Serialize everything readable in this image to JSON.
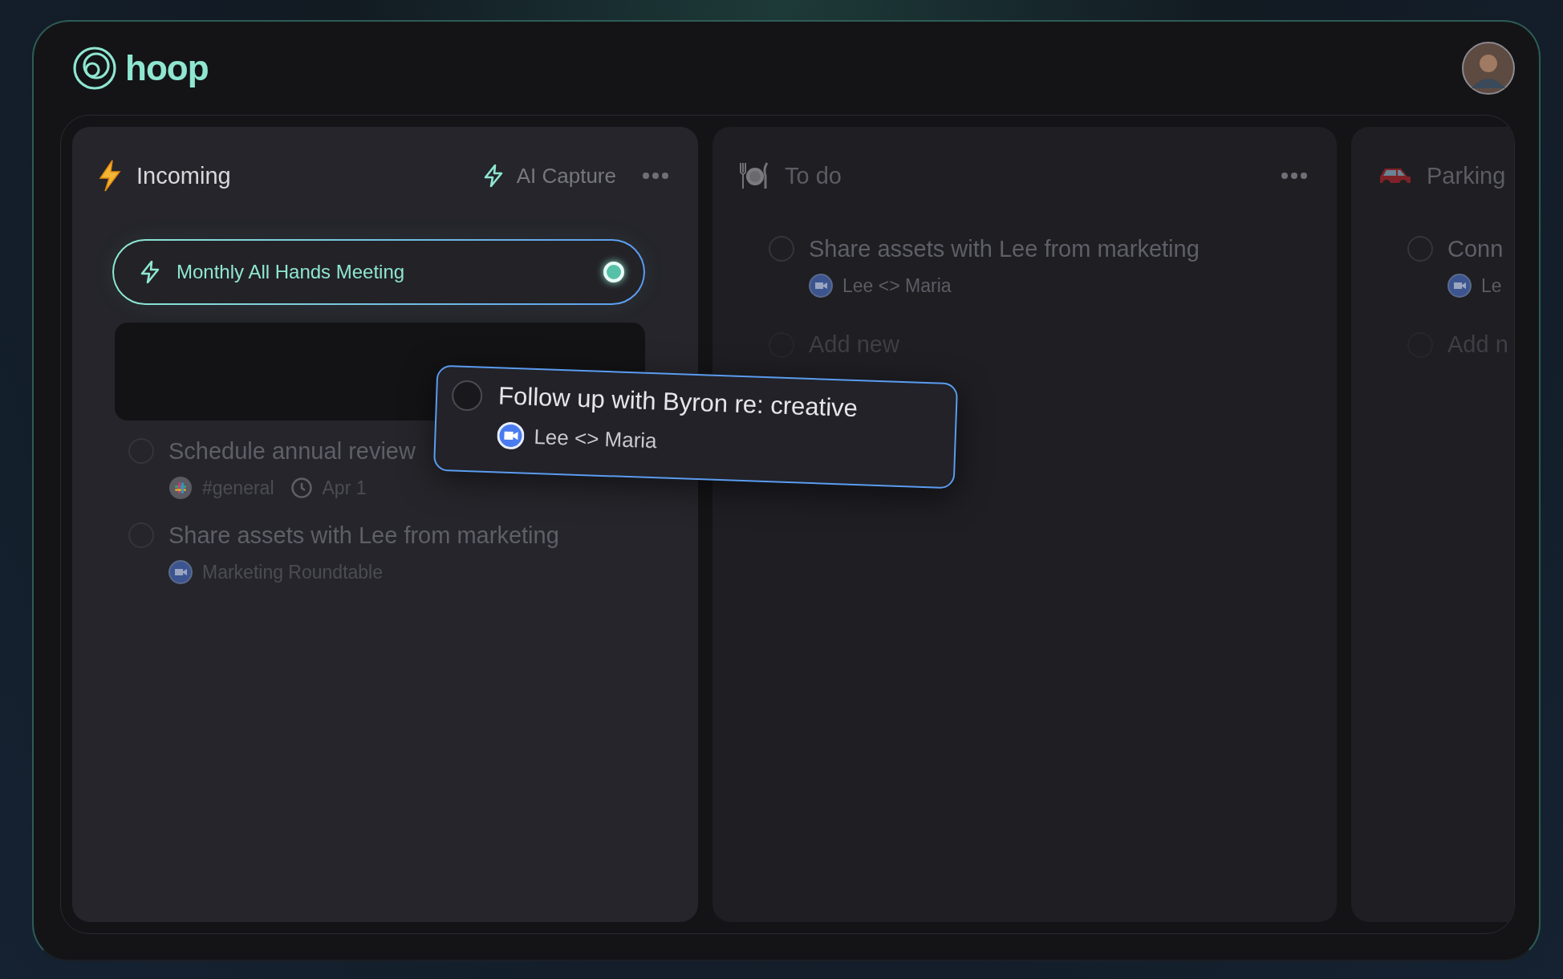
{
  "app": {
    "logo": "hoop"
  },
  "columns": [
    {
      "title": "Incoming",
      "action": "AI Capture",
      "has_menu": true,
      "capture": {
        "title": "Monthly All Hands Meeting",
        "live": true
      },
      "drop_slot": true,
      "tasks": [
        {
          "title": "Schedule annual review",
          "checked": false,
          "meta": [
            {
              "kind": "slack",
              "text": "#general"
            },
            {
              "kind": "date",
              "text": "Apr 1"
            }
          ]
        },
        {
          "title": "Share assets with Lee from marketing",
          "checked": false,
          "meta": [
            {
              "kind": "video",
              "text": "Marketing Roundtable"
            }
          ]
        }
      ]
    },
    {
      "title": "To do",
      "has_menu": true,
      "drop_slot": false,
      "tasks": [
        {
          "title": "Share assets with Lee from marketing",
          "checked": false,
          "meta": [
            {
              "kind": "video",
              "text": "Lee <> Maria"
            }
          ]
        }
      ],
      "add_label": "Add new"
    },
    {
      "title": "Parking",
      "has_menu": false,
      "drop_slot": false,
      "tasks": [
        {
          "title": "Conn",
          "checked": false,
          "meta": [
            {
              "kind": "video",
              "text": "Le"
            }
          ]
        }
      ],
      "add_label": "Add n"
    }
  ],
  "dragged_card": {
    "title": "Follow up with Byron re: creative",
    "checked": false,
    "meta": [
      {
        "kind": "video",
        "text": "Lee <> Maria"
      }
    ]
  }
}
